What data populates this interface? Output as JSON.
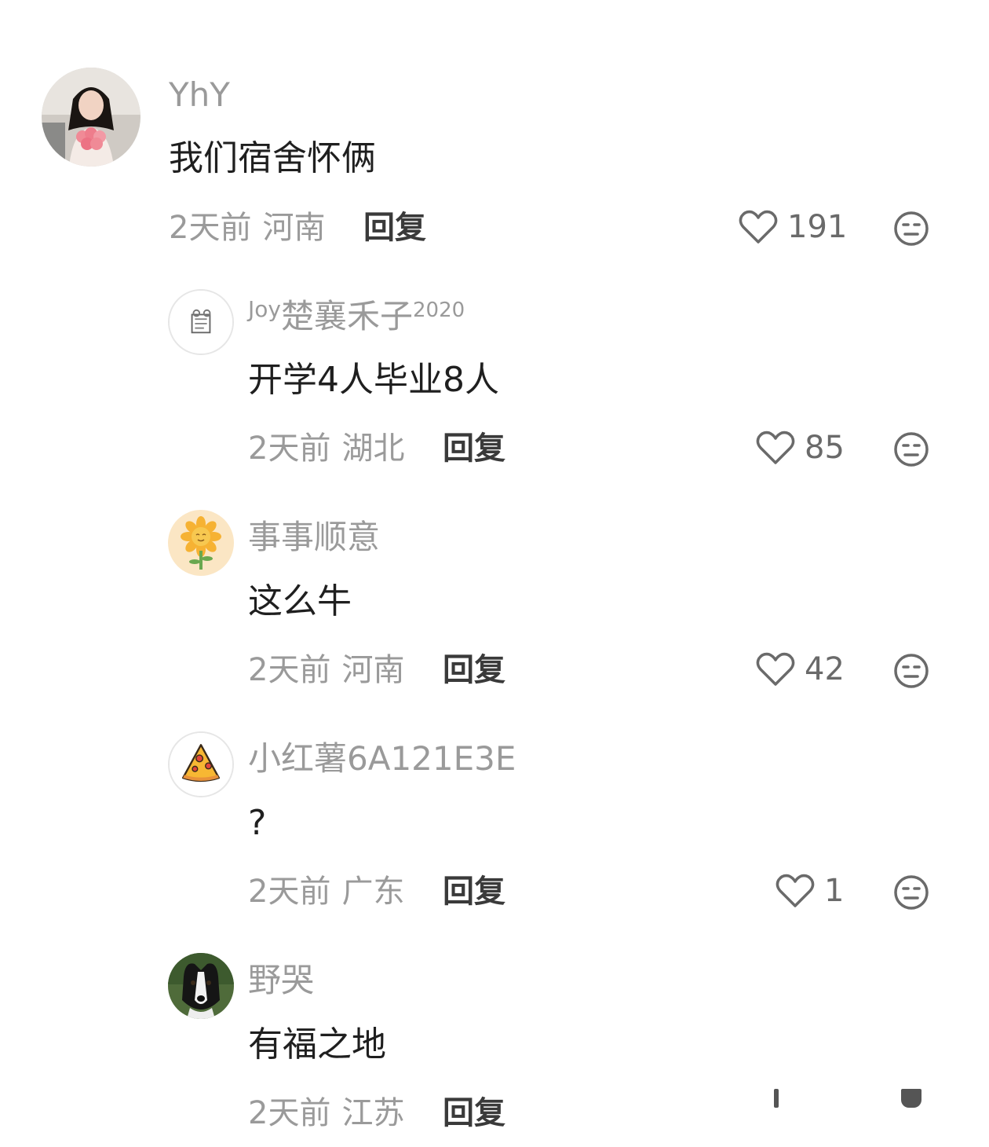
{
  "comments": [
    {
      "username": "YhY",
      "content": "我们宿舍怀俩",
      "time": "2天前",
      "location": "河南",
      "reply_label": "回复",
      "likes": "191"
    },
    {
      "username_prefix": "Joy",
      "username_main": "楚襄禾子",
      "username_suffix": "2020",
      "content": "开学4人毕业8人",
      "time": "2天前",
      "location": "湖北",
      "reply_label": "回复",
      "likes": "85"
    },
    {
      "username": "事事顺意",
      "content": "这么牛",
      "time": "2天前",
      "location": "河南",
      "reply_label": "回复",
      "likes": "42"
    },
    {
      "username": "小红薯6A121E3E",
      "content": "?",
      "time": "2天前",
      "location": "广东",
      "reply_label": "回复",
      "likes": "1"
    },
    {
      "username": "野哭",
      "content": "有福之地",
      "time": "2天前",
      "location": "江苏",
      "reply_label": "回复"
    }
  ],
  "icons": {
    "like": "heart-outline-icon",
    "dislike": "neutral-face-icon"
  },
  "colors": {
    "username": "#9a9a9a",
    "content": "#1f1f1f",
    "meta": "#9a9a9a",
    "reply": "#3a3a3a",
    "icon": "#6a6a6a"
  }
}
